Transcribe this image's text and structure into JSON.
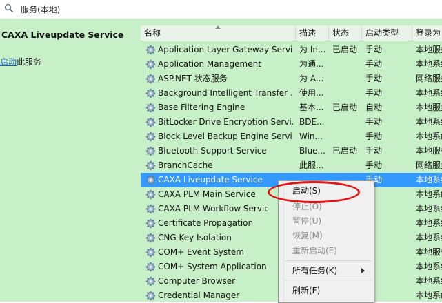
{
  "window": {
    "title": "服务(本地)",
    "title_icon": "search-icon"
  },
  "left_panel": {
    "service_name": "CAXA Liveupdate Service",
    "action_link": "启动",
    "action_suffix": "此服务"
  },
  "columns": [
    {
      "label": "名称"
    },
    {
      "label": "描述"
    },
    {
      "label": "状态"
    },
    {
      "label": "启动类型"
    },
    {
      "label": "登录为"
    }
  ],
  "services": [
    {
      "name": "Application Layer Gateway Servi",
      "desc": "为 In...",
      "status": "已启动",
      "startup": "手动",
      "logon": "本地服务"
    },
    {
      "name": "Application Management",
      "desc": "为通...",
      "status": "",
      "startup": "手动",
      "logon": "本地系统"
    },
    {
      "name": "ASP.NET 状态服务",
      "desc": "为 A...",
      "status": "",
      "startup": "手动",
      "logon": "网络服务"
    },
    {
      "name": "Background Intelligent Transfer ...",
      "desc": "使用...",
      "status": "",
      "startup": "手动",
      "logon": "本地系统"
    },
    {
      "name": "Base Filtering Engine",
      "desc": "基本...",
      "status": "已启动",
      "startup": "自动",
      "logon": "本地服务"
    },
    {
      "name": "BitLocker Drive Encryption Servi...",
      "desc": "BDE...",
      "status": "",
      "startup": "手动",
      "logon": "本地系统"
    },
    {
      "name": "Block Level Backup Engine Servi...",
      "desc": "Win...",
      "status": "",
      "startup": "手动",
      "logon": "本地系统"
    },
    {
      "name": "Bluetooth Support Service",
      "desc": "Blue...",
      "status": "已启动",
      "startup": "手动",
      "logon": "本地服务"
    },
    {
      "name": "BranchCache",
      "desc": "此服...",
      "status": "",
      "startup": "手动",
      "logon": "网络服务"
    },
    {
      "name": "CAXA Liveupdate Service",
      "desc": "",
      "status": "",
      "startup": "手动",
      "logon": "本地系统"
    },
    {
      "name": "CAXA PLM Main Service",
      "desc": "",
      "status": "",
      "startup": "",
      "logon": "本地系统"
    },
    {
      "name": "CAXA PLM Workflow Servic",
      "desc": "",
      "status": "",
      "startup": "",
      "logon": "本地系统"
    },
    {
      "name": "Certificate Propagation",
      "desc": "",
      "status": "",
      "startup": "",
      "logon": "本地系统"
    },
    {
      "name": "CNG Key Isolation",
      "desc": "",
      "status": "",
      "startup": "",
      "logon": "本地系统"
    },
    {
      "name": "COM+ Event System",
      "desc": "",
      "status": "",
      "startup": "",
      "logon": "本地服务"
    },
    {
      "name": "COM+ System Application",
      "desc": "",
      "status": "",
      "startup": "",
      "logon": "本地系统"
    },
    {
      "name": "Computer Browser",
      "desc": "",
      "status": "",
      "startup": "用",
      "logon": "本地系统"
    },
    {
      "name": "Credential Manager",
      "desc": "",
      "status": "",
      "startup": "",
      "logon": "本地系统"
    }
  ],
  "selected_index": 9,
  "context_menu": {
    "items": [
      {
        "label": "启动(S)",
        "enabled": true
      },
      {
        "label": "停止(O)",
        "enabled": false
      },
      {
        "label": "暂停(U)",
        "enabled": false
      },
      {
        "label": "恢复(M)",
        "enabled": false
      },
      {
        "label": "重新启动(E)",
        "enabled": false
      },
      {
        "label": "所有任务(K)",
        "enabled": true,
        "submenu": true
      },
      {
        "label": "刷新(F)",
        "enabled": true
      }
    ]
  },
  "colors": {
    "pane_bg": "#c8f0c8",
    "selection": "#3399ff",
    "highlight_ring": "#e81010"
  }
}
